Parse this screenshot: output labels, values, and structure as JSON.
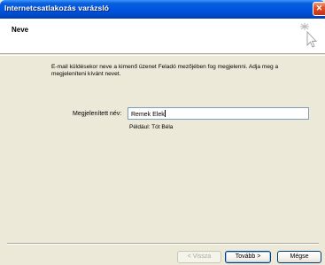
{
  "window": {
    "title": "Internetcsatlakozás varázsló",
    "close_glyph": "✕"
  },
  "header": {
    "title": "Neve",
    "icon": "cursor-sparkle-icon"
  },
  "content": {
    "description": "E-mail küldésekor neve a kimenő üzenet Feladó mezőjében fog megjelenni. Adja meg a megjeleníteni kívánt nevet.",
    "display_name_label": "Megjelenített név:",
    "display_name_value": "Remek Elek",
    "example_text": "Például: Tót Béla"
  },
  "buttons": {
    "back": "< Vissza",
    "next": "Tovább >",
    "cancel": "Mégse"
  },
  "colors": {
    "titlebar": "#0054e3",
    "dialog_bg": "#ece9d8",
    "close_button": "#e0502a"
  }
}
